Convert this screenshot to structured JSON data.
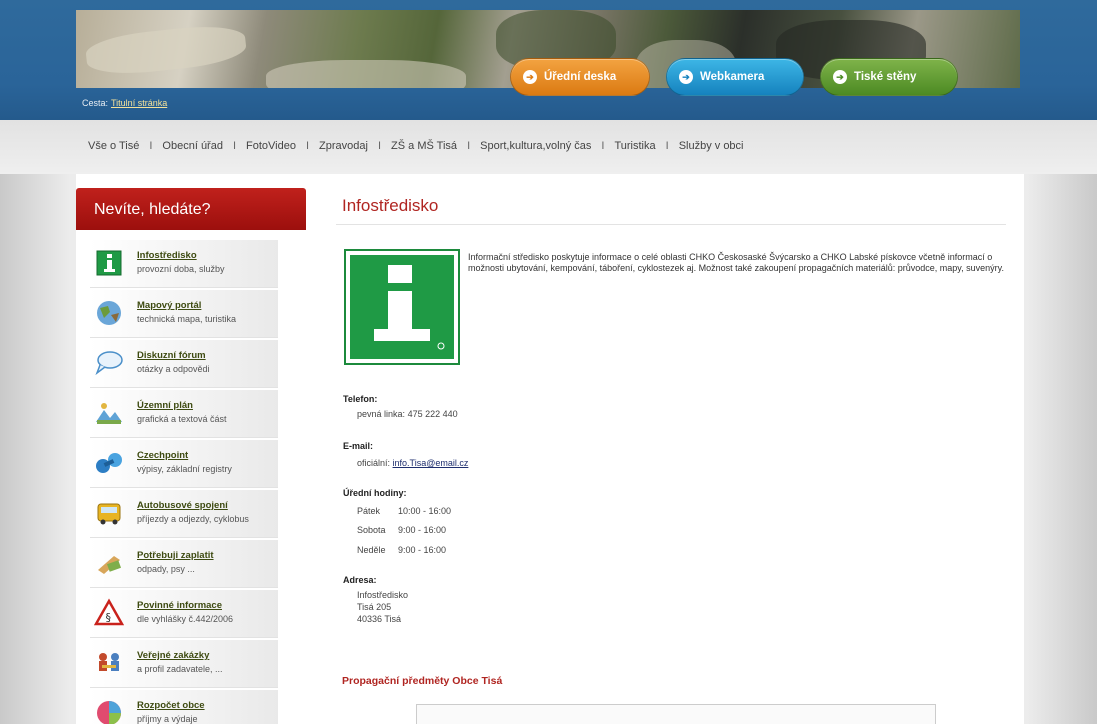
{
  "header": {
    "pills": [
      {
        "label": "Úřední deska",
        "color": "#e58a1e"
      },
      {
        "label": "Webkamera",
        "color": "#1e90c8"
      },
      {
        "label": "Tiské stěny",
        "color": "#5b9a2c"
      }
    ],
    "breadcrumb": {
      "label": "Cesta:",
      "link": "Titulní stránka"
    }
  },
  "topnav": {
    "items": [
      "Vše o Tisé",
      "Obecní úřad",
      "FotoVideo",
      "Zpravodaj",
      "ZŠ a MŠ Tisá",
      "Sport,kultura,volný čas",
      "Turistika",
      "Služby v obci"
    ],
    "separator": "I"
  },
  "sidebar": {
    "heading": "Nevíte, hledáte?",
    "items": [
      {
        "title": "Infostředisko",
        "subtitle": "provozní doba, služby",
        "icon": "info-icon"
      },
      {
        "title": "Mapový portál",
        "subtitle": "technická mapa, turistika",
        "icon": "map-globe-icon"
      },
      {
        "title": "Diskuzní fórum",
        "subtitle": "otázky a odpovědi",
        "icon": "chat-bubbles-icon"
      },
      {
        "title": "Územní plán",
        "subtitle": "grafická a textová část",
        "icon": "landscape-plan-icon"
      },
      {
        "title": "Czechpoint",
        "subtitle": "výpisy, základní registry",
        "icon": "czechpoint-icon"
      },
      {
        "title": "Autobusové spojení",
        "subtitle": "příjezdy a odjezdy, cyklobus",
        "icon": "bus-icon"
      },
      {
        "title": "Potřebuji zaplatit",
        "subtitle": "odpady, psy ...",
        "icon": "payment-icon"
      },
      {
        "title": "Povinné informace",
        "subtitle": "dle vyhlášky č.442/2006",
        "icon": "warning-paragraph-icon"
      },
      {
        "title": "Veřejné zakázky",
        "subtitle": "a profil zadavatele, ...",
        "icon": "contracts-icon"
      },
      {
        "title": "Rozpočet obce",
        "subtitle": "příjmy a výdaje",
        "icon": "budget-pie-icon"
      }
    ]
  },
  "main": {
    "title": "Infostředisko",
    "intro": "Informační středisko poskytuje informace o celé oblasti CHKO Českosaské Švýcarsko a CHKO Labské pískovce včetně informací o možnosti ubytování, kempování, táboření, cyklostezek aj. Možnost také zakoupení propagačních materiálů: průvodce, mapy, suvenýry.",
    "phone": {
      "label": "Telefon:",
      "prefix": "pevná linka:",
      "value": "475 222 440"
    },
    "email": {
      "label": "E-mail:",
      "prefix": "oficiální:",
      "value": "info.Tisa@email.cz"
    },
    "hours": {
      "label": "Úřední hodiny:",
      "rows": [
        {
          "day": "Pátek",
          "time": "10:00 - 16:00"
        },
        {
          "day": "Sobota",
          "time": "9:00 - 16:00"
        },
        {
          "day": "Neděle",
          "time": "9:00 - 16:00"
        }
      ]
    },
    "address": {
      "label": "Adresa:",
      "lines": [
        "Infostředisko",
        "Tisá 205",
        "40336 Tisá"
      ]
    },
    "promo_heading": "Propagační předměty Obce Tisá"
  }
}
